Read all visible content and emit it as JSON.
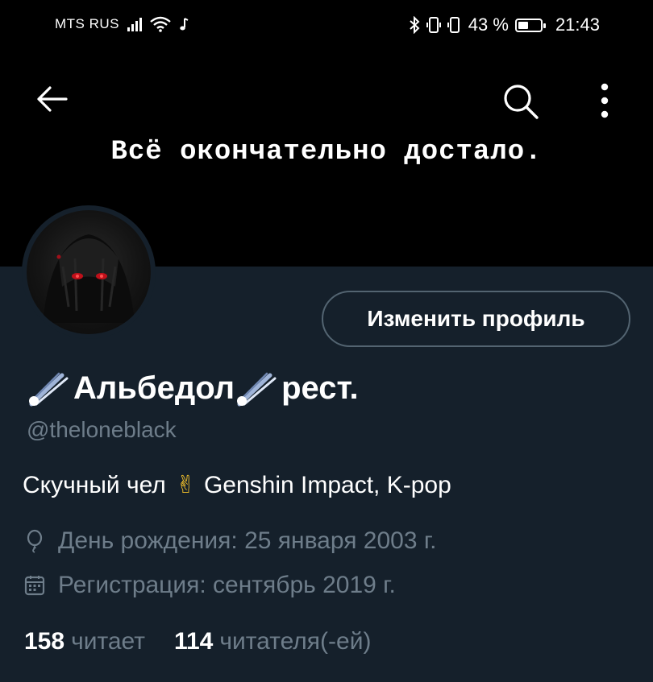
{
  "status_bar": {
    "carrier": "MTS RUS",
    "battery_percent": "43 %",
    "time": "21:43"
  },
  "header": {
    "banner_text": "Всё окончательно достало.",
    "icons": [
      "back-arrow-icon",
      "search-icon",
      "more-vertical-icon"
    ]
  },
  "profile": {
    "edit_button_label": "Изменить профиль",
    "name_part1": "Альбедол",
    "name_part2": "рест.",
    "handle": "@theloneblack",
    "bio_text1": "Скучный чел",
    "bio_emoji": "✌",
    "bio_text2": "Genshin Impact, K-pop",
    "birthday": "День рождения: 25 января 2003 г.",
    "joined": "Регистрация: сентябрь 2019 г."
  },
  "stats": {
    "following_count": "158",
    "following_label": "читает",
    "followers_count": "114",
    "followers_label": "читателя(-ей)"
  },
  "colors": {
    "background": "#15202b",
    "banner": "#000000",
    "muted_text": "#6e7d8a",
    "button_border": "#536471"
  }
}
